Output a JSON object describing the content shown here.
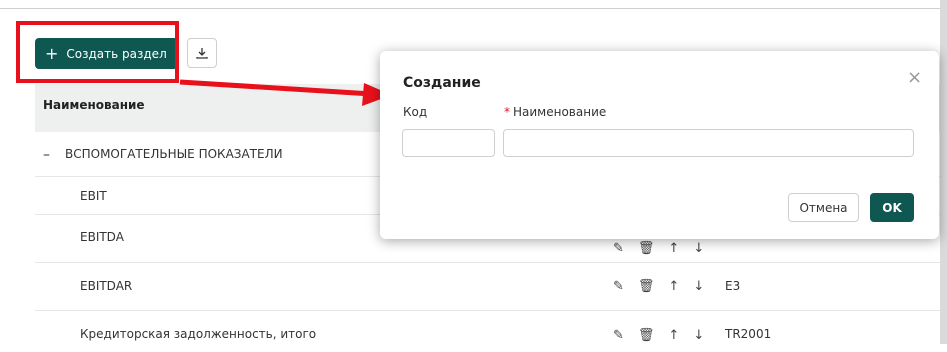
{
  "toolbar": {
    "create_section_label": "Создать раздел",
    "create_icon": "plus-icon",
    "download_icon": "download-icon"
  },
  "table": {
    "header_name": "Наименование",
    "group": {
      "toggle": "–",
      "label": "ВСПОМОГАТЕЛЬНЫЕ ПОКАЗАТЕЛИ"
    },
    "rows": [
      {
        "label": "EBIT",
        "code": ""
      },
      {
        "label": "EBITDA",
        "code": ""
      },
      {
        "label": "EBITDAR",
        "code": "E3"
      },
      {
        "label": "Кредиторская задолженность, итого",
        "code": "TR2001"
      }
    ],
    "action_icons": [
      "edit-icon",
      "delete-icon",
      "arrow-up-icon",
      "arrow-down-icon"
    ]
  },
  "modal": {
    "title": "Создание",
    "close": "×",
    "code_label": "Код",
    "name_required_mark": "*",
    "name_label": "Наименование",
    "code_value": "",
    "name_value": "",
    "cancel_label": "Отмена",
    "ok_label": "OK"
  },
  "colors": {
    "accent": "#0f5751",
    "highlight": "#e8111b",
    "header_bg": "#eef0ef"
  }
}
